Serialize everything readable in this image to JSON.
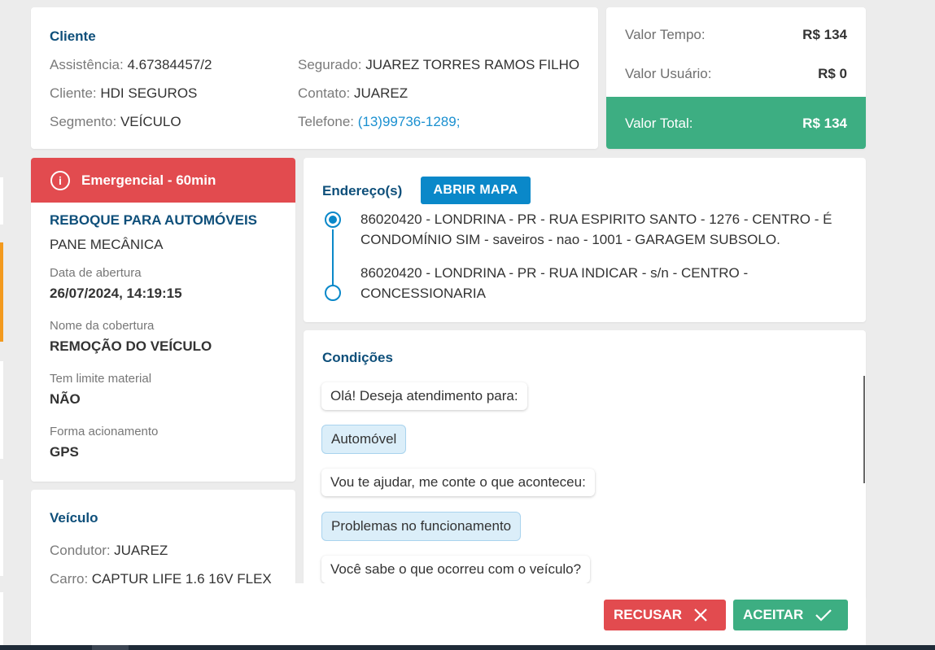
{
  "client": {
    "title": "Cliente",
    "assistencia_label": "Assistência:",
    "assistencia_value": "4.67384457/2",
    "cliente_label": "Cliente:",
    "cliente_value": "HDI SEGUROS",
    "segmento_label": "Segmento:",
    "segmento_value": "VEÍCULO",
    "segurado_label": "Segurado:",
    "segurado_value": "JUAREZ TORRES RAMOS FILHO",
    "contato_label": "Contato:",
    "contato_value": "JUAREZ",
    "telefone_label": "Telefone:",
    "telefone_value": "(13)99736-1289;"
  },
  "values": {
    "tempo_label": "Valor Tempo:",
    "tempo_value": "R$ 134",
    "usuario_label": "Valor Usuário:",
    "usuario_value": "R$ 0",
    "total_label": "Valor Total:",
    "total_value": "R$ 134"
  },
  "service": {
    "priority": "Emergencial - 60min",
    "type": "REBOQUE PARA AUTOMÓVEIS",
    "problem": "PANE MECÂNICA",
    "opened_label": "Data de abertura",
    "opened_value": "26/07/2024, 14:19:15",
    "coverage_label": "Nome da cobertura",
    "coverage_value": "REMOÇÃO DO VEÍCULO",
    "limit_label": "Tem limite material",
    "limit_value": "NÃO",
    "trigger_label": "Forma acionamento",
    "trigger_value": "GPS"
  },
  "vehicle": {
    "title": "Veículo",
    "driver_label": "Condutor:",
    "driver_value": "JUAREZ",
    "car_label": "Carro:",
    "car_value": "CAPTUR LIFE 1.6 16V FLEX"
  },
  "address": {
    "title": "Endereço(s)",
    "map_button": "ABRIR MAPA",
    "origin_line1": "86020420 - LONDRINA - PR - RUA ESPIRITO SANTO - 1276 - CENTRO - É",
    "origin_line2": "CONDOMÍNIO SIM - saveiros - nao - 1001 - GARAGEM SUBSOLO.",
    "destination_line1": "86020420 - LONDRINA - PR - RUA INDICAR - s/n - CENTRO -",
    "destination_line2": "CONCESSIONARIA"
  },
  "conditions": {
    "title": "Condições",
    "messages": [
      "Olá! Deseja atendimento para:",
      "Automóvel",
      "Vou te ajudar, me conte o que aconteceu:",
      "Problemas no funcionamento",
      "Você sabe o que ocorreu com o veículo?"
    ]
  },
  "actions": {
    "reject_label": "RECUSAR",
    "accept_label": "ACEITAR"
  },
  "colors": {
    "primary_title": "#0e4f7a",
    "link": "#1b90d0",
    "success": "#3dae82",
    "danger": "#e24b4f",
    "map_button": "#0a88c9"
  },
  "icons": {
    "priority": "info-circle-icon",
    "reject": "close-icon",
    "accept": "check-icon"
  }
}
